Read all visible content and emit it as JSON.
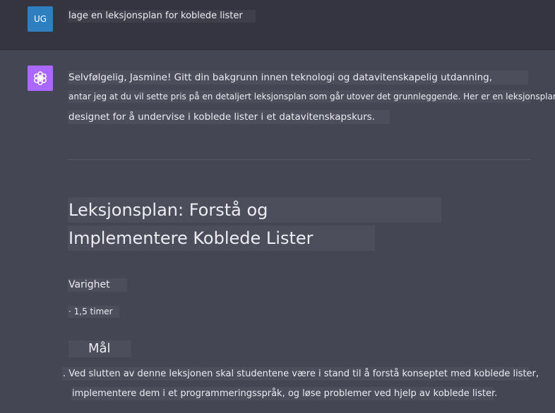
{
  "user": {
    "avatar_initials": "UG",
    "message": "lage en leksjonsplan for koblede lister"
  },
  "assistant": {
    "avatar_icon": "openai-logo-icon",
    "intro_lines": [
      "Selvfølgelig, Jasmine! Gitt din bakgrunn innen teknologi og datavitenskapelig utdanning,",
      "antar jeg at du vil sette pris på en detaljert leksjonsplan som går utover det grunnleggende. Her er en leksjonsplan",
      "designet for å undervise i koblede lister i et datavitenskapskurs."
    ],
    "title_lines": [
      "Leksjonsplan: Forstå og",
      "Implementere Koblede Lister"
    ],
    "duration_heading": "Varighet",
    "duration_item": "· 1,5 timer",
    "goal_heading": "Mål",
    "goal_lines": [
      ". Ved slutten av denne leksjonen skal studentene være i stand til å forstå konseptet med koblede lister,",
      "implementere dem i et programmeringsspråk, og løse problemer ved hjelp av koblede lister."
    ]
  },
  "colors": {
    "page_bg": "#444654",
    "user_row_bg": "#343541",
    "user_avatar": "#2e7fbf",
    "bot_avatar": "#ab68ff",
    "text": "#ececf1"
  }
}
